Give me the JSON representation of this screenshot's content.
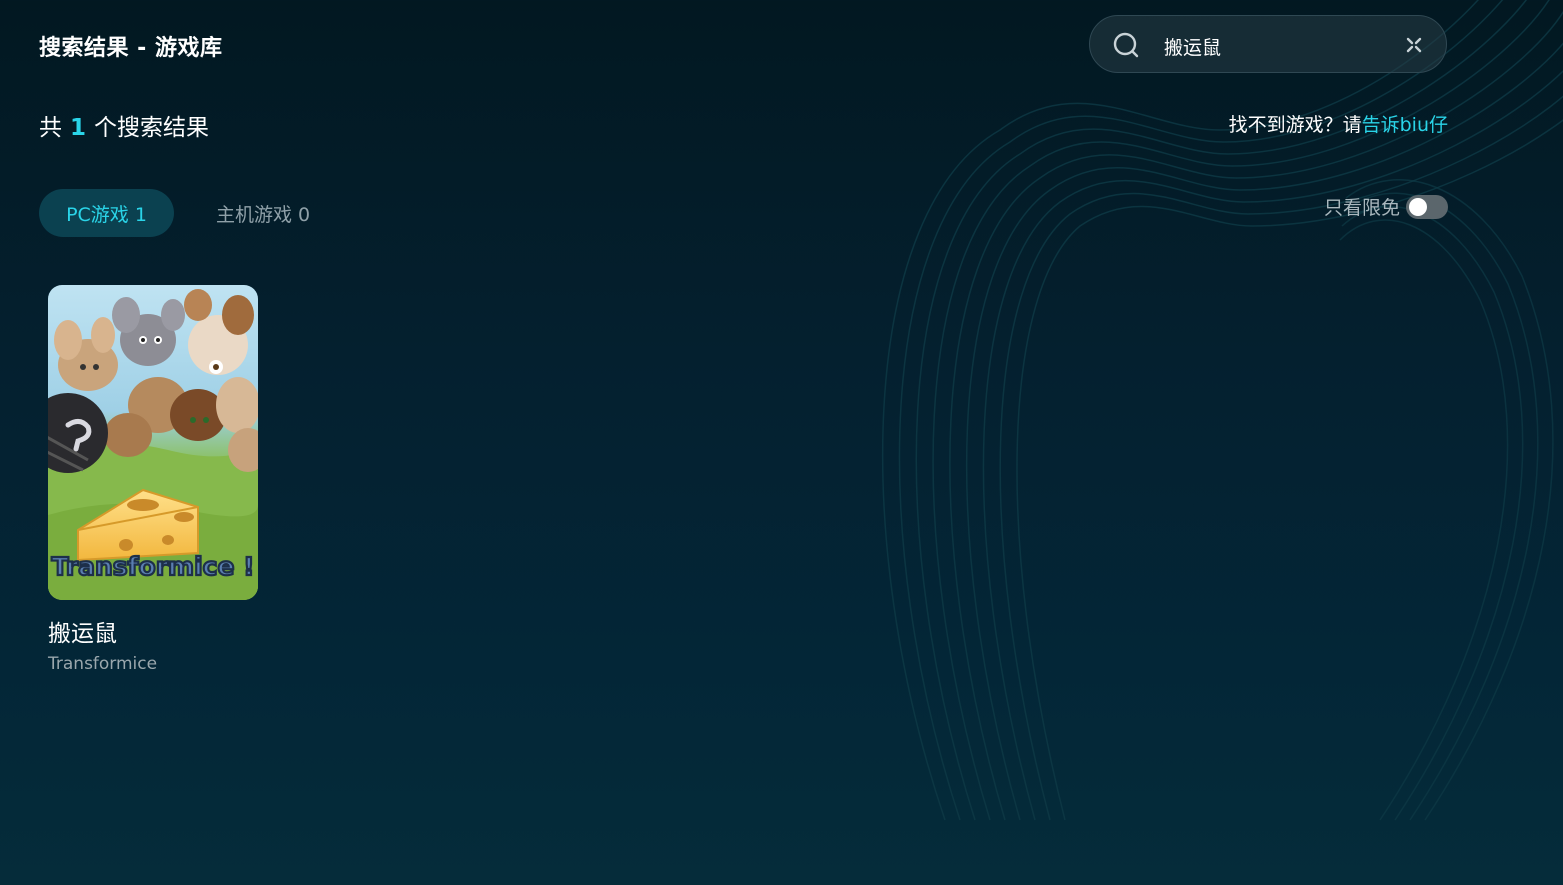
{
  "header": {
    "title": "搜索结果 - 游戏库"
  },
  "search": {
    "value": "搬运鼠",
    "placeholder": ""
  },
  "results": {
    "prefix": "共",
    "count": "1",
    "suffix": "个搜索结果"
  },
  "help": {
    "text": "找不到游戏？请",
    "link": "告诉biu仔"
  },
  "tabs": [
    {
      "label": "PC游戏 1",
      "active": true
    },
    {
      "label": "主机游戏 0",
      "active": false
    }
  ],
  "filter": {
    "free_only_label": "只看限免",
    "free_only_enabled": false
  },
  "games": [
    {
      "title": "搬运鼠",
      "subtitle": "Transformice",
      "cover_logo": "Transformice !"
    }
  ],
  "icons": {
    "search": "search-icon",
    "clear": "close-icon"
  },
  "colors": {
    "accent": "#2ad4e8",
    "background": "#04202f",
    "tab_active_bg": "#0b4150",
    "muted_text": "#8fa0a8"
  }
}
